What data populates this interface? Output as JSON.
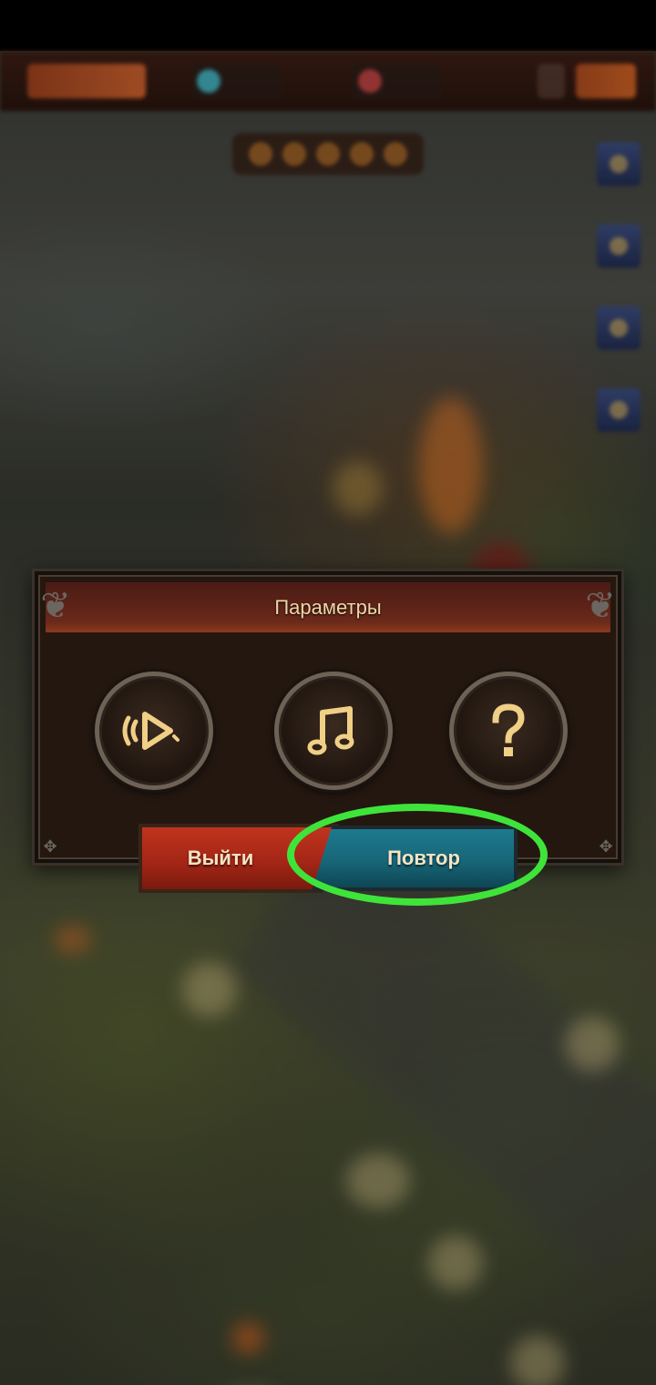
{
  "dialog": {
    "title": "Параметры",
    "buttons": [
      {
        "name": "sound-icon"
      },
      {
        "name": "music-note-icon"
      },
      {
        "name": "question-mark-icon"
      }
    ],
    "exit_label": "Выйти",
    "retry_label": "Повтор"
  },
  "highlight": {
    "color": "#3fe43a",
    "target": "Повтор"
  },
  "colors": {
    "accent_gold": "#f0d7a8",
    "exit_red": "#a52616",
    "retry_teal": "#176678",
    "header_red": "#5c2218"
  }
}
